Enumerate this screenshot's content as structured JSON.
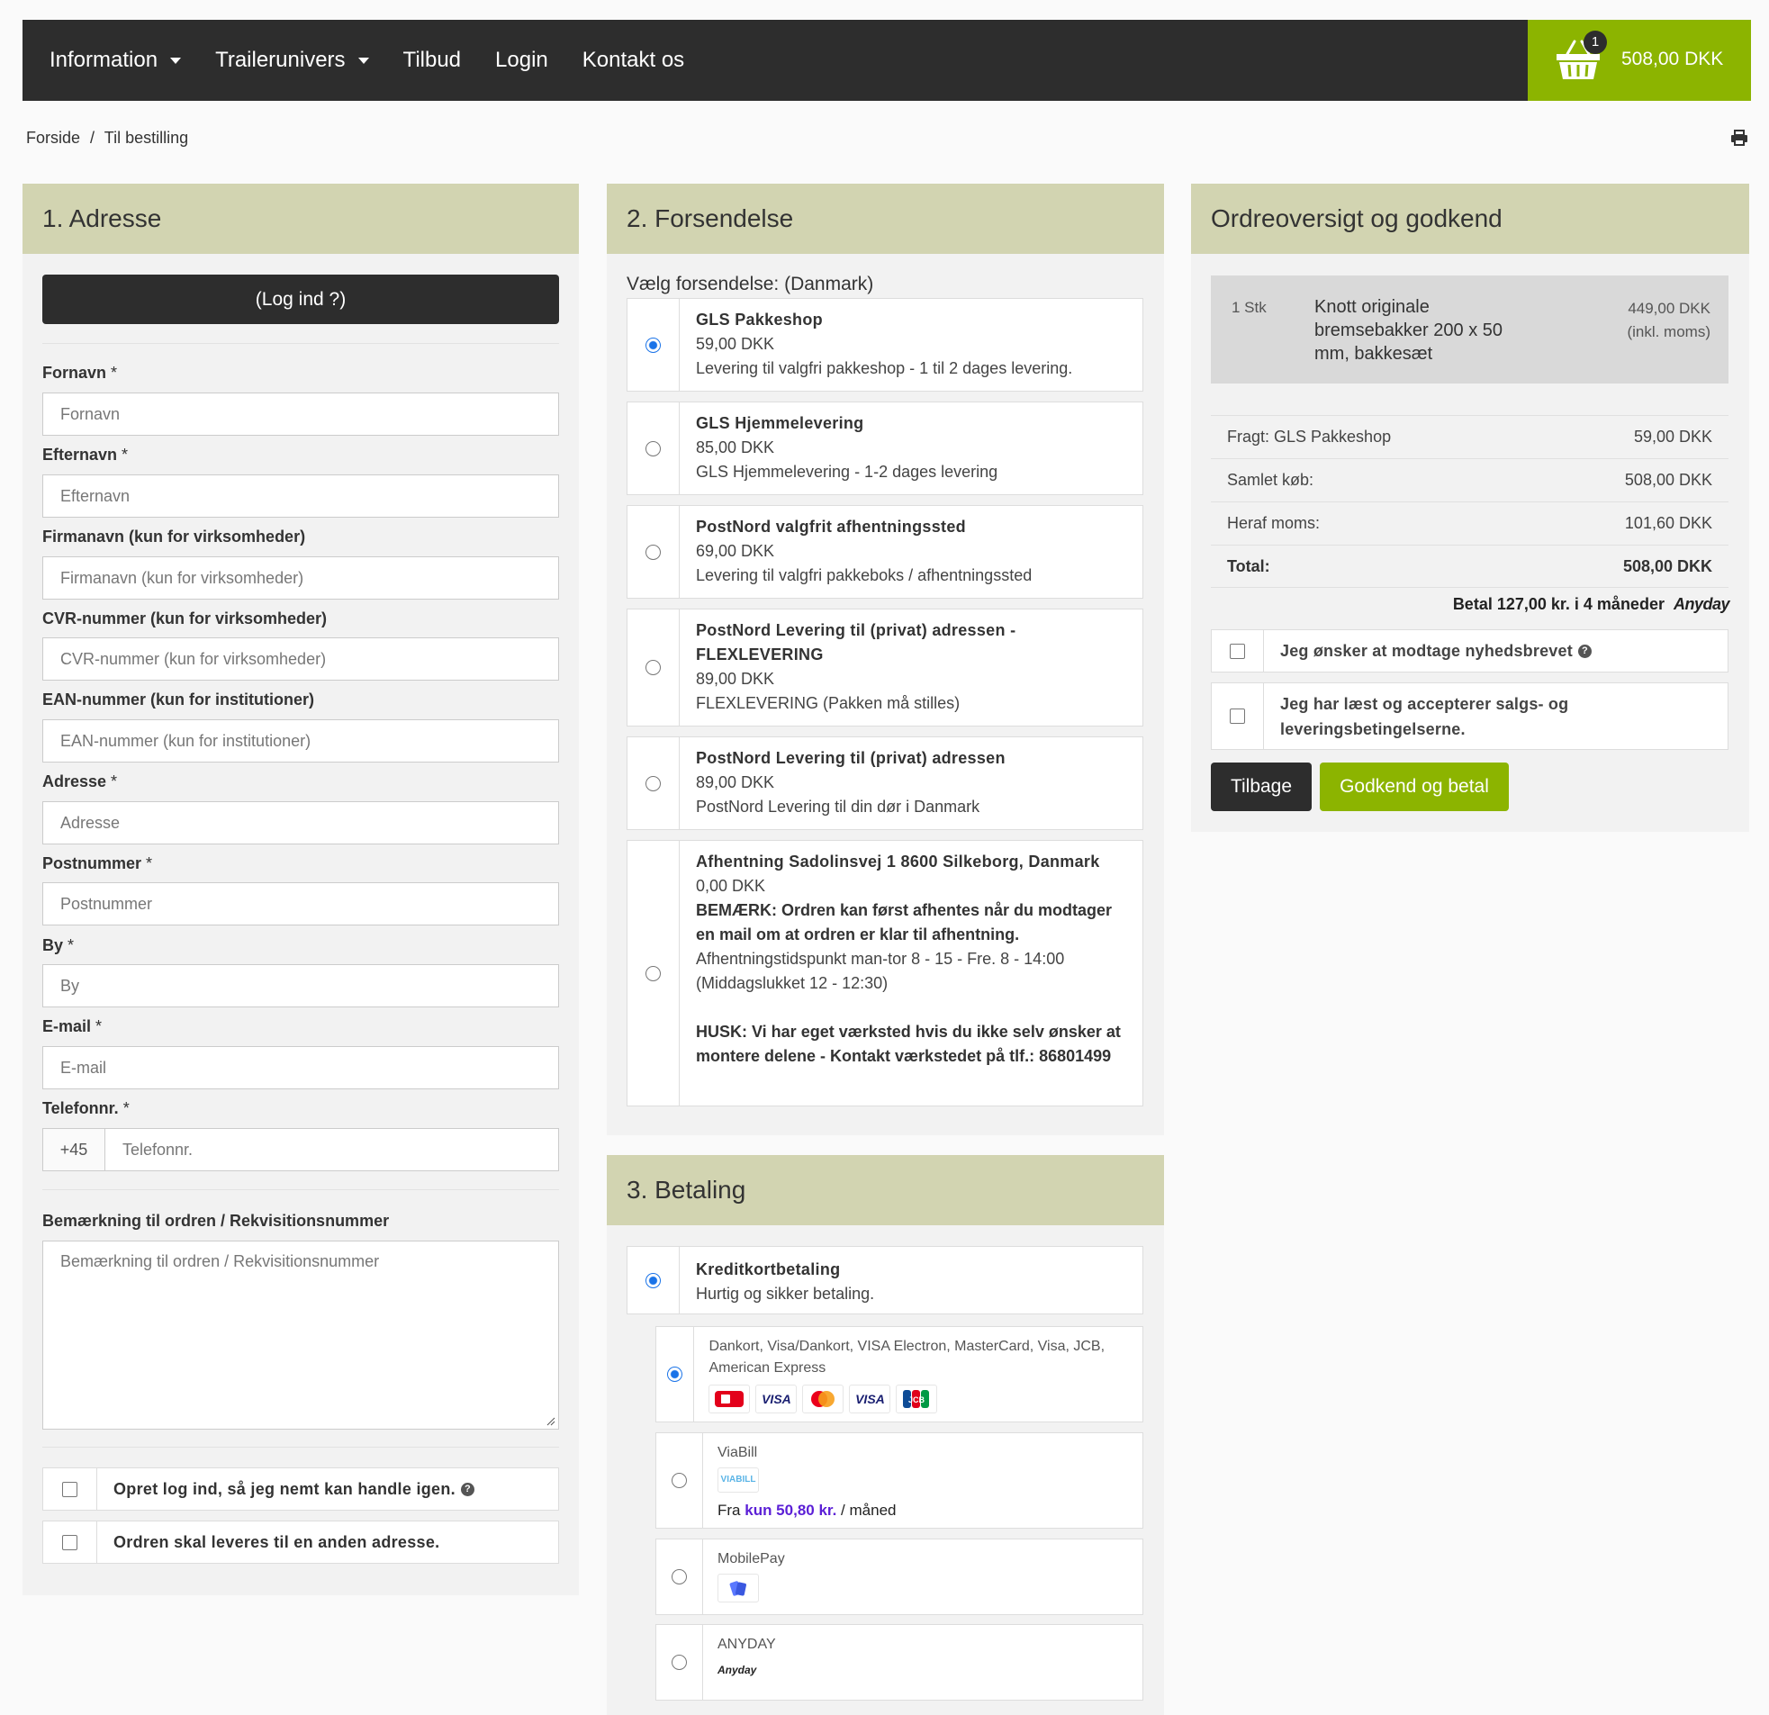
{
  "nav": {
    "items": [
      {
        "label": "Information",
        "dropdown": true
      },
      {
        "label": "Trailerunivers",
        "dropdown": true
      },
      {
        "label": "Tilbud",
        "dropdown": false
      },
      {
        "label": "Login",
        "dropdown": false
      },
      {
        "label": "Kontakt os",
        "dropdown": false
      }
    ],
    "cart_count": "1",
    "cart_total": "508,00 DKK"
  },
  "breadcrumb": {
    "home": "Forside",
    "sep": "/",
    "current": "Til bestilling"
  },
  "address": {
    "title": "1. Adresse",
    "login_button": "(Log ind ?)",
    "fields": [
      {
        "label": "Fornavn",
        "required": " *",
        "placeholder": "Fornavn"
      },
      {
        "label": "Efternavn",
        "required": " *",
        "placeholder": "Efternavn"
      },
      {
        "label": "Firmanavn (kun for virksomheder)",
        "required": "",
        "placeholder": "Firmanavn (kun for virksomheder)"
      },
      {
        "label": "CVR-nummer (kun for virksomheder)",
        "required": "",
        "placeholder": "CVR-nummer (kun for virksomheder)"
      },
      {
        "label": "EAN-nummer (kun for institutioner)",
        "required": "",
        "placeholder": "EAN-nummer (kun for institutioner)"
      },
      {
        "label": "Adresse",
        "required": " *",
        "placeholder": "Adresse"
      },
      {
        "label": "Postnummer",
        "required": " *",
        "placeholder": "Postnummer"
      },
      {
        "label": "By",
        "required": " *",
        "placeholder": "By"
      },
      {
        "label": "E-mail",
        "required": " *",
        "placeholder": "E-mail"
      }
    ],
    "phone": {
      "label": "Telefonnr.",
      "required": " *",
      "prefix": "+45",
      "placeholder": "Telefonnr."
    },
    "note": {
      "label": "Bemærkning til ordren / Rekvisitionsnummer",
      "placeholder": "Bemærkning til ordren / Rekvisitionsnummer"
    },
    "create_login": "Opret log ind, så jeg nemt kan handle igen.",
    "other_address": "Ordren skal leveres til en anden adresse."
  },
  "shipping": {
    "title": "2. Forsendelse",
    "choose": "Vælg forsendelse: (Danmark)",
    "options": [
      {
        "name": "GLS Pakkeshop",
        "price": "59,00 DKK",
        "desc": "Levering til valgfri pakkeshop - 1 til 2 dages levering.",
        "selected": true
      },
      {
        "name": "GLS Hjemmelevering",
        "price": "85,00 DKK",
        "desc": "GLS Hjemmelevering - 1-2 dages levering",
        "selected": false
      },
      {
        "name": "PostNord valgfrit afhentningssted",
        "price": "69,00 DKK",
        "desc": "Levering til valgfri pakkeboks / afhentningssted",
        "selected": false
      },
      {
        "name": "PostNord Levering til (privat) adressen - FLEXLEVERING",
        "price": "89,00 DKK",
        "desc": "FLEXLEVERING (Pakken må stilles)",
        "selected": false
      },
      {
        "name": "PostNord Levering til (privat) adressen",
        "price": "89,00 DKK",
        "desc": "PostNord Levering til din dør i Danmark",
        "selected": false
      }
    ],
    "pickup": {
      "name": "Afhentning Sadolinsvej 1 8600 Silkeborg, Danmark",
      "price": "0,00 DKK",
      "note": "BEMÆRK: Ordren kan først afhentes når du modtager en mail om at ordren er klar til afhentning.",
      "hours": "Afhentningstidspunkt man-tor 8 - 15 - Fre. 8 - 14:00 (Middagslukket 12 - 12:30)",
      "remember": "HUSK: Vi har eget værksted hvis du ikke selv ønsker at montere delene - Kontakt værkstedet på tlf.: 86801499"
    }
  },
  "payment": {
    "title": "3. Betaling",
    "main": {
      "name": "Kreditkortbetaling",
      "desc": "Hurtig og sikker betaling."
    },
    "cards_desc": "Dankort, Visa/Dankort, VISA Electron, MasterCard, Visa, JCB, American Express",
    "card_logos": [
      "Dankort",
      "VISA",
      "MasterCard",
      "VISA",
      "JCB"
    ],
    "viabill": {
      "name": "ViaBill",
      "logo": "VIABILL",
      "from": "Fra",
      "amount": "kun 50,80 kr.",
      "per": "/ måned"
    },
    "mobilepay": {
      "name": "MobilePay"
    },
    "anyday": {
      "name": "ANYDAY",
      "logo": "Anyday"
    }
  },
  "summary": {
    "title": "Ordreoversigt og godkend",
    "item": {
      "qty": "1 Stk",
      "name": "Knott originale bremsebakker 200 x 50 mm, bakkesæt",
      "price": "449,00 DKK",
      "price_note": "(inkl. moms)"
    },
    "rows": [
      {
        "label": "Fragt: GLS Pakkeshop",
        "value": "59,00 DKK"
      },
      {
        "label": "Samlet køb:",
        "value": "508,00 DKK"
      },
      {
        "label": "Heraf moms:",
        "value": "101,60 DKK"
      }
    ],
    "total": {
      "label": "Total:",
      "value": "508,00 DKK"
    },
    "anyday_text": "Betal 127,00 kr. i 4 måneder",
    "anyday_brand": "Anyday",
    "newsletter": "Jeg ønsker at modtage nyhedsbrevet",
    "terms": "Jeg har læst og accepterer salgs- og leveringsbetingelserne.",
    "back_button": "Tilbage",
    "approve_button": "Godkend og betal"
  },
  "colors": {
    "accent": "#8cb400",
    "dark": "#2d2d2d",
    "panel_head": "#d2d4b1",
    "link_blue": "#1a73e8"
  }
}
